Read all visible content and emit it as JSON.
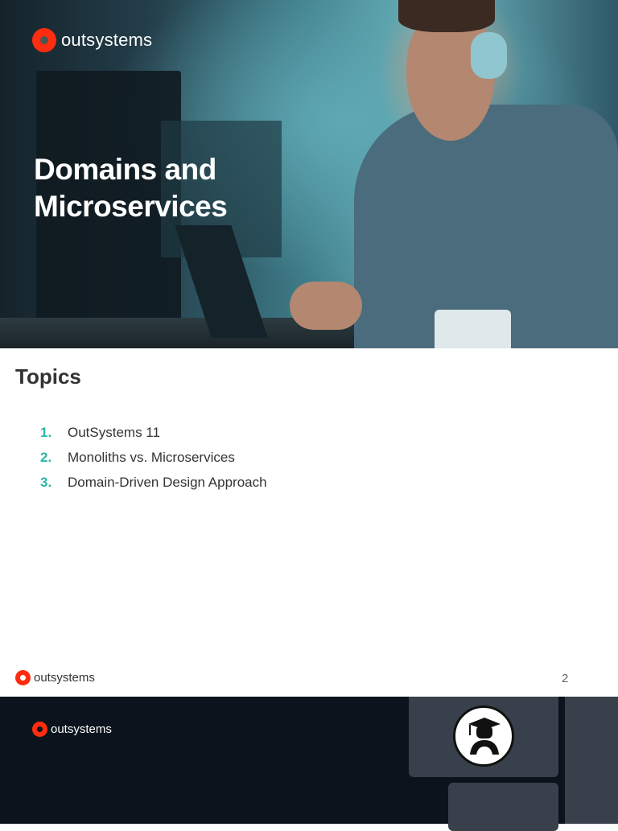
{
  "brand": {
    "name": "outsystems",
    "accent_color": "#ff2d0f",
    "number_color": "#2bb5a8"
  },
  "hero": {
    "title_line1": "Domains and",
    "title_line2": "Microservices"
  },
  "topics": {
    "heading": "Topics",
    "items": [
      {
        "number": "1.",
        "label": "OutSystems 11"
      },
      {
        "number": "2.",
        "label": "Monoliths vs. Microservices"
      },
      {
        "number": "3.",
        "label": "Domain-Driven Design Approach"
      }
    ]
  },
  "footer": {
    "page_number": "2"
  },
  "next_slide": {
    "avatar_icon": "graduate-avatar-icon"
  }
}
